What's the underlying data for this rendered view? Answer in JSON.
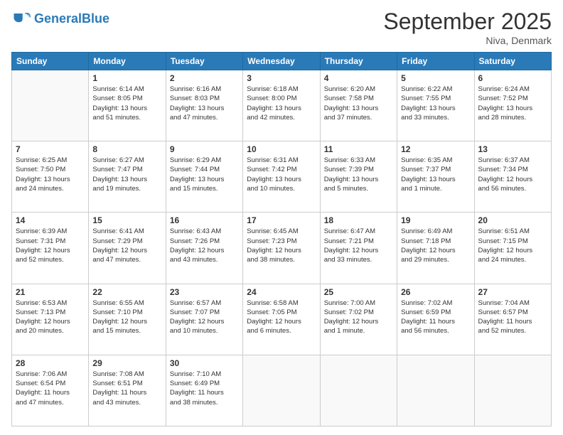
{
  "header": {
    "logo_general": "General",
    "logo_blue": "Blue",
    "month_title": "September 2025",
    "location": "Niva, Denmark"
  },
  "days_of_week": [
    "Sunday",
    "Monday",
    "Tuesday",
    "Wednesday",
    "Thursday",
    "Friday",
    "Saturday"
  ],
  "weeks": [
    [
      {
        "day": "",
        "info": ""
      },
      {
        "day": "1",
        "info": "Sunrise: 6:14 AM\nSunset: 8:05 PM\nDaylight: 13 hours\nand 51 minutes."
      },
      {
        "day": "2",
        "info": "Sunrise: 6:16 AM\nSunset: 8:03 PM\nDaylight: 13 hours\nand 47 minutes."
      },
      {
        "day": "3",
        "info": "Sunrise: 6:18 AM\nSunset: 8:00 PM\nDaylight: 13 hours\nand 42 minutes."
      },
      {
        "day": "4",
        "info": "Sunrise: 6:20 AM\nSunset: 7:58 PM\nDaylight: 13 hours\nand 37 minutes."
      },
      {
        "day": "5",
        "info": "Sunrise: 6:22 AM\nSunset: 7:55 PM\nDaylight: 13 hours\nand 33 minutes."
      },
      {
        "day": "6",
        "info": "Sunrise: 6:24 AM\nSunset: 7:52 PM\nDaylight: 13 hours\nand 28 minutes."
      }
    ],
    [
      {
        "day": "7",
        "info": "Sunrise: 6:25 AM\nSunset: 7:50 PM\nDaylight: 13 hours\nand 24 minutes."
      },
      {
        "day": "8",
        "info": "Sunrise: 6:27 AM\nSunset: 7:47 PM\nDaylight: 13 hours\nand 19 minutes."
      },
      {
        "day": "9",
        "info": "Sunrise: 6:29 AM\nSunset: 7:44 PM\nDaylight: 13 hours\nand 15 minutes."
      },
      {
        "day": "10",
        "info": "Sunrise: 6:31 AM\nSunset: 7:42 PM\nDaylight: 13 hours\nand 10 minutes."
      },
      {
        "day": "11",
        "info": "Sunrise: 6:33 AM\nSunset: 7:39 PM\nDaylight: 13 hours\nand 5 minutes."
      },
      {
        "day": "12",
        "info": "Sunrise: 6:35 AM\nSunset: 7:37 PM\nDaylight: 13 hours\nand 1 minute."
      },
      {
        "day": "13",
        "info": "Sunrise: 6:37 AM\nSunset: 7:34 PM\nDaylight: 12 hours\nand 56 minutes."
      }
    ],
    [
      {
        "day": "14",
        "info": "Sunrise: 6:39 AM\nSunset: 7:31 PM\nDaylight: 12 hours\nand 52 minutes."
      },
      {
        "day": "15",
        "info": "Sunrise: 6:41 AM\nSunset: 7:29 PM\nDaylight: 12 hours\nand 47 minutes."
      },
      {
        "day": "16",
        "info": "Sunrise: 6:43 AM\nSunset: 7:26 PM\nDaylight: 12 hours\nand 43 minutes."
      },
      {
        "day": "17",
        "info": "Sunrise: 6:45 AM\nSunset: 7:23 PM\nDaylight: 12 hours\nand 38 minutes."
      },
      {
        "day": "18",
        "info": "Sunrise: 6:47 AM\nSunset: 7:21 PM\nDaylight: 12 hours\nand 33 minutes."
      },
      {
        "day": "19",
        "info": "Sunrise: 6:49 AM\nSunset: 7:18 PM\nDaylight: 12 hours\nand 29 minutes."
      },
      {
        "day": "20",
        "info": "Sunrise: 6:51 AM\nSunset: 7:15 PM\nDaylight: 12 hours\nand 24 minutes."
      }
    ],
    [
      {
        "day": "21",
        "info": "Sunrise: 6:53 AM\nSunset: 7:13 PM\nDaylight: 12 hours\nand 20 minutes."
      },
      {
        "day": "22",
        "info": "Sunrise: 6:55 AM\nSunset: 7:10 PM\nDaylight: 12 hours\nand 15 minutes."
      },
      {
        "day": "23",
        "info": "Sunrise: 6:57 AM\nSunset: 7:07 PM\nDaylight: 12 hours\nand 10 minutes."
      },
      {
        "day": "24",
        "info": "Sunrise: 6:58 AM\nSunset: 7:05 PM\nDaylight: 12 hours\nand 6 minutes."
      },
      {
        "day": "25",
        "info": "Sunrise: 7:00 AM\nSunset: 7:02 PM\nDaylight: 12 hours\nand 1 minute."
      },
      {
        "day": "26",
        "info": "Sunrise: 7:02 AM\nSunset: 6:59 PM\nDaylight: 11 hours\nand 56 minutes."
      },
      {
        "day": "27",
        "info": "Sunrise: 7:04 AM\nSunset: 6:57 PM\nDaylight: 11 hours\nand 52 minutes."
      }
    ],
    [
      {
        "day": "28",
        "info": "Sunrise: 7:06 AM\nSunset: 6:54 PM\nDaylight: 11 hours\nand 47 minutes."
      },
      {
        "day": "29",
        "info": "Sunrise: 7:08 AM\nSunset: 6:51 PM\nDaylight: 11 hours\nand 43 minutes."
      },
      {
        "day": "30",
        "info": "Sunrise: 7:10 AM\nSunset: 6:49 PM\nDaylight: 11 hours\nand 38 minutes."
      },
      {
        "day": "",
        "info": ""
      },
      {
        "day": "",
        "info": ""
      },
      {
        "day": "",
        "info": ""
      },
      {
        "day": "",
        "info": ""
      }
    ]
  ]
}
